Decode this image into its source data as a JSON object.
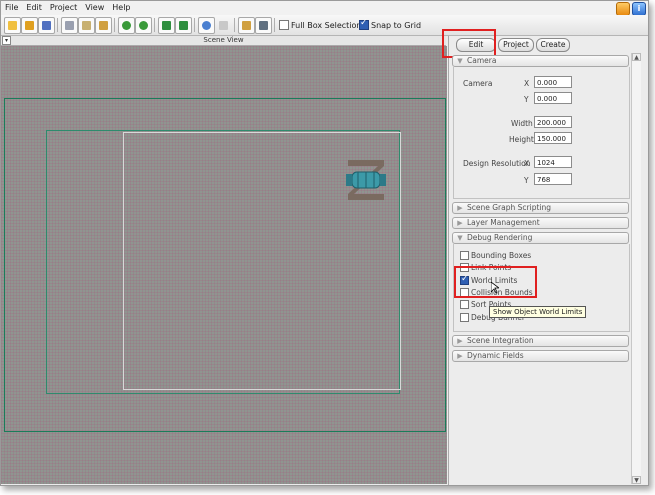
{
  "menu": {
    "items": [
      "File",
      "Edit",
      "Project",
      "View",
      "Help"
    ]
  },
  "toolbar": {
    "full_box_selection": "Full Box Selection",
    "snap_to_grid": "Snap to Grid"
  },
  "scene": {
    "title": "Scene View"
  },
  "panel": {
    "tabs": [
      "Edit",
      "Project",
      "Create"
    ],
    "camera": {
      "header": "Camera",
      "camera_label": "Camera",
      "x_label": "X",
      "x_value": "0.000",
      "y_label": "Y",
      "y_value": "0.000",
      "width_label": "Width",
      "width_value": "200.000",
      "height_label": "Height",
      "height_value": "150.000",
      "design_res_label": "Design Resolution",
      "res_x_label": "X",
      "res_x_value": "1024",
      "res_y_label": "Y",
      "res_y_value": "768"
    },
    "sections_collapsed_top": [
      "Scene Graph Scripting",
      "Layer Management"
    ],
    "debug": {
      "header": "Debug Rendering",
      "options": [
        {
          "label": "Bounding Boxes",
          "checked": false
        },
        {
          "label": "Link Points",
          "checked": false
        },
        {
          "label": "World Limits",
          "checked": true
        },
        {
          "label": "Collision Bounds",
          "checked": false
        },
        {
          "label": "Sort Points",
          "checked": false
        },
        {
          "label": "Debug Banner",
          "checked": false
        }
      ],
      "tooltip": "Show Object World Limits"
    },
    "sections_collapsed_bottom": [
      "Scene Integration",
      "Dynamic Fields"
    ]
  },
  "colors": {
    "highlight": "#e02020",
    "scene_bg": "#8f9590",
    "world_limit": "#1a7c5a"
  }
}
